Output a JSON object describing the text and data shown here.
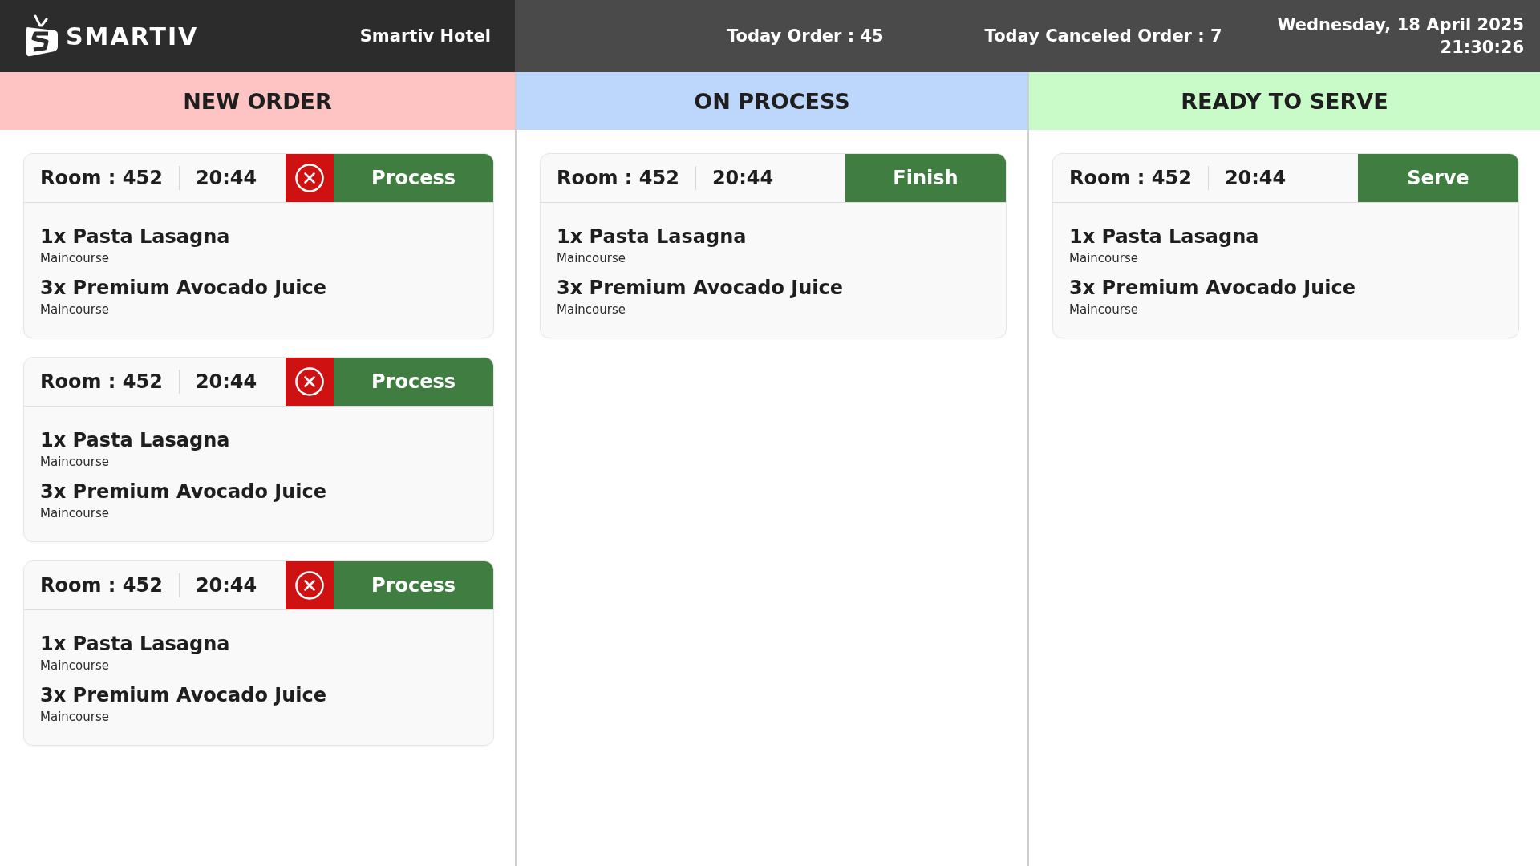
{
  "header": {
    "brand": "SMARTIV",
    "hotel": "Smartiv Hotel",
    "today_order": "Today Order : 45",
    "canceled_order": "Today Canceled Order : 7",
    "date": "Wednesday, 18 April 2025",
    "time": "21:30:26"
  },
  "columns": [
    {
      "title": "NEW ORDER",
      "color": "#fec4c4",
      "orders": [
        {
          "room": "Room : 452",
          "time": "20:44",
          "cancelable": true,
          "action": "Process",
          "items": [
            {
              "name": "1x Pasta Lasagna",
              "category": "Maincourse"
            },
            {
              "name": "3x Premium Avocado Juice",
              "category": "Maincourse"
            }
          ]
        },
        {
          "room": "Room : 452",
          "time": "20:44",
          "cancelable": true,
          "action": "Process",
          "items": [
            {
              "name": "1x Pasta Lasagna",
              "category": "Maincourse"
            },
            {
              "name": "3x Premium Avocado Juice",
              "category": "Maincourse"
            }
          ]
        },
        {
          "room": "Room : 452",
          "time": "20:44",
          "cancelable": true,
          "action": "Process",
          "items": [
            {
              "name": "1x Pasta Lasagna",
              "category": "Maincourse"
            },
            {
              "name": "3x Premium Avocado Juice",
              "category": "Maincourse"
            }
          ]
        }
      ]
    },
    {
      "title": "ON PROCESS",
      "color": "#bdd6fb",
      "orders": [
        {
          "room": "Room : 452",
          "time": "20:44",
          "cancelable": false,
          "action": "Finish",
          "items": [
            {
              "name": "1x Pasta Lasagna",
              "category": "Maincourse"
            },
            {
              "name": "3x Premium Avocado Juice",
              "category": "Maincourse"
            }
          ]
        }
      ]
    },
    {
      "title": "READY TO SERVE",
      "color": "#c9fbc9",
      "orders": [
        {
          "room": "Room : 452",
          "time": "20:44",
          "cancelable": false,
          "action": "Serve",
          "items": [
            {
              "name": "1x Pasta Lasagna",
              "category": "Maincourse"
            },
            {
              "name": "3x Premium Avocado Juice",
              "category": "Maincourse"
            }
          ]
        }
      ]
    }
  ]
}
